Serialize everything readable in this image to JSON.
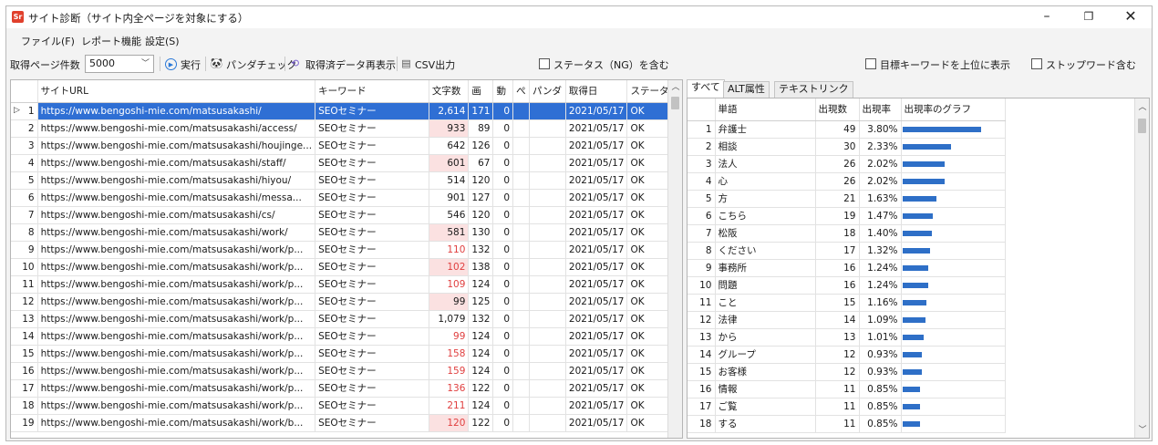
{
  "window": {
    "title": "サイト診断（サイト内全ページを対象にする）",
    "app_icon_text": "Sr",
    "minimize": "–",
    "maximize": "❐",
    "close": "✕"
  },
  "menu": [
    {
      "label": "ファイル(F)"
    },
    {
      "label": "レポート機能"
    },
    {
      "label": "設定(S)"
    }
  ],
  "toolbar": {
    "page_count_label": "取得ページ件数",
    "page_count_value": "5000",
    "run_label": "実行",
    "panda_label": "パンダチェック",
    "redisplay_label": "取得済データ再表示",
    "csv_label": "CSV出力",
    "status_ng_label": "ステータス（NG）を含む",
    "target_kw_label": "目標キーワードを上位に表示",
    "stopword_label": "ストップワード含む"
  },
  "left_grid": {
    "columns": [
      "サイトURL",
      "キーワード",
      "文字数",
      "画",
      "動",
      "ぺ",
      "パンダ",
      "取得日",
      "ステータス"
    ],
    "rows": [
      {
        "n": "1",
        "url": "https://www.bengoshi-mie.com/matsusakashi/",
        "kw": "SEOセミナー",
        "chars": "2,614",
        "img": "171",
        "mov": "0",
        "pe": "",
        "panda": "",
        "date": "2021/05/17",
        "status": "OK",
        "warn": false,
        "selected": true
      },
      {
        "n": "2",
        "url": "https://www.bengoshi-mie.com/matsusakashi/access/",
        "kw": "SEOセミナー",
        "chars": "933",
        "img": "89",
        "mov": "0",
        "pe": "",
        "panda": "",
        "date": "2021/05/17",
        "status": "OK",
        "warn": "cell"
      },
      {
        "n": "3",
        "url": "https://www.bengoshi-mie.com/matsusakashi/houjinge...",
        "kw": "SEOセミナー",
        "chars": "642",
        "img": "126",
        "mov": "0",
        "pe": "",
        "panda": "",
        "date": "2021/05/17",
        "status": "OK",
        "warn": false
      },
      {
        "n": "4",
        "url": "https://www.bengoshi-mie.com/matsusakashi/staff/",
        "kw": "SEOセミナー",
        "chars": "601",
        "img": "67",
        "mov": "0",
        "pe": "",
        "panda": "",
        "date": "2021/05/17",
        "status": "OK",
        "warn": "cell"
      },
      {
        "n": "5",
        "url": "https://www.bengoshi-mie.com/matsusakashi/hiyou/",
        "kw": "SEOセミナー",
        "chars": "514",
        "img": "120",
        "mov": "0",
        "pe": "",
        "panda": "",
        "date": "2021/05/17",
        "status": "OK",
        "warn": false
      },
      {
        "n": "6",
        "url": "https://www.bengoshi-mie.com/matsusakashi/messa...",
        "kw": "SEOセミナー",
        "chars": "901",
        "img": "127",
        "mov": "0",
        "pe": "",
        "panda": "",
        "date": "2021/05/17",
        "status": "OK",
        "warn": false
      },
      {
        "n": "7",
        "url": "https://www.bengoshi-mie.com/matsusakashi/cs/",
        "kw": "SEOセミナー",
        "chars": "546",
        "img": "120",
        "mov": "0",
        "pe": "",
        "panda": "",
        "date": "2021/05/17",
        "status": "OK",
        "warn": false
      },
      {
        "n": "8",
        "url": "https://www.bengoshi-mie.com/matsusakashi/work/",
        "kw": "SEOセミナー",
        "chars": "581",
        "img": "130",
        "mov": "0",
        "pe": "",
        "panda": "",
        "date": "2021/05/17",
        "status": "OK",
        "warn": "cell"
      },
      {
        "n": "9",
        "url": "https://www.bengoshi-mie.com/matsusakashi/work/p...",
        "kw": "SEOセミナー",
        "chars": "110",
        "img": "132",
        "mov": "0",
        "pe": "",
        "panda": "",
        "date": "2021/05/17",
        "status": "OK",
        "warn": "text"
      },
      {
        "n": "10",
        "url": "https://www.bengoshi-mie.com/matsusakashi/work/p...",
        "kw": "SEOセミナー",
        "chars": "102",
        "img": "138",
        "mov": "0",
        "pe": "",
        "panda": "",
        "date": "2021/05/17",
        "status": "OK",
        "warn": "both"
      },
      {
        "n": "11",
        "url": "https://www.bengoshi-mie.com/matsusakashi/work/p...",
        "kw": "SEOセミナー",
        "chars": "109",
        "img": "124",
        "mov": "0",
        "pe": "",
        "panda": "",
        "date": "2021/05/17",
        "status": "OK",
        "warn": "text"
      },
      {
        "n": "12",
        "url": "https://www.bengoshi-mie.com/matsusakashi/work/p...",
        "kw": "SEOセミナー",
        "chars": "99",
        "img": "125",
        "mov": "0",
        "pe": "",
        "panda": "",
        "date": "2021/05/17",
        "status": "OK",
        "warn": "cell"
      },
      {
        "n": "13",
        "url": "https://www.bengoshi-mie.com/matsusakashi/work/p...",
        "kw": "SEOセミナー",
        "chars": "1,079",
        "img": "132",
        "mov": "0",
        "pe": "",
        "panda": "",
        "date": "2021/05/17",
        "status": "OK",
        "warn": false
      },
      {
        "n": "14",
        "url": "https://www.bengoshi-mie.com/matsusakashi/work/p...",
        "kw": "SEOセミナー",
        "chars": "99",
        "img": "124",
        "mov": "0",
        "pe": "",
        "panda": "",
        "date": "2021/05/17",
        "status": "OK",
        "warn": "text"
      },
      {
        "n": "15",
        "url": "https://www.bengoshi-mie.com/matsusakashi/work/p...",
        "kw": "SEOセミナー",
        "chars": "158",
        "img": "124",
        "mov": "0",
        "pe": "",
        "panda": "",
        "date": "2021/05/17",
        "status": "OK",
        "warn": "text"
      },
      {
        "n": "16",
        "url": "https://www.bengoshi-mie.com/matsusakashi/work/p...",
        "kw": "SEOセミナー",
        "chars": "159",
        "img": "124",
        "mov": "0",
        "pe": "",
        "panda": "",
        "date": "2021/05/17",
        "status": "OK",
        "warn": "text"
      },
      {
        "n": "17",
        "url": "https://www.bengoshi-mie.com/matsusakashi/work/p...",
        "kw": "SEOセミナー",
        "chars": "136",
        "img": "122",
        "mov": "0",
        "pe": "",
        "panda": "",
        "date": "2021/05/17",
        "status": "OK",
        "warn": "text"
      },
      {
        "n": "18",
        "url": "https://www.bengoshi-mie.com/matsusakashi/work/p...",
        "kw": "SEOセミナー",
        "chars": "211",
        "img": "124",
        "mov": "0",
        "pe": "",
        "panda": "",
        "date": "2021/05/17",
        "status": "OK",
        "warn": "text"
      },
      {
        "n": "19",
        "url": "https://www.bengoshi-mie.com/matsusakashi/work/b...",
        "kw": "SEOセミナー",
        "chars": "120",
        "img": "122",
        "mov": "0",
        "pe": "",
        "panda": "",
        "date": "2021/05/17",
        "status": "OK",
        "warn": "both"
      }
    ]
  },
  "right_tabs": [
    {
      "label": "すべて",
      "active": true
    },
    {
      "label": "ALT属性",
      "active": false
    },
    {
      "label": "テキストリンク",
      "active": false
    }
  ],
  "right_grid": {
    "columns": [
      "単語",
      "出現数",
      "出現率",
      "出現率のグラフ"
    ],
    "rows": [
      {
        "n": "1",
        "word": "弁護士",
        "count": "49",
        "rate": "3.80%",
        "frac": 1.0
      },
      {
        "n": "2",
        "word": "相談",
        "count": "30",
        "rate": "2.33%",
        "frac": 0.613
      },
      {
        "n": "3",
        "word": "法人",
        "count": "26",
        "rate": "2.02%",
        "frac": 0.532
      },
      {
        "n": "4",
        "word": "心",
        "count": "26",
        "rate": "2.02%",
        "frac": 0.532
      },
      {
        "n": "5",
        "word": "方",
        "count": "21",
        "rate": "1.63%",
        "frac": 0.429
      },
      {
        "n": "6",
        "word": "こちら",
        "count": "19",
        "rate": "1.47%",
        "frac": 0.387
      },
      {
        "n": "7",
        "word": "松阪",
        "count": "18",
        "rate": "1.40%",
        "frac": 0.368
      },
      {
        "n": "8",
        "word": "ください",
        "count": "17",
        "rate": "1.32%",
        "frac": 0.347
      },
      {
        "n": "9",
        "word": "事務所",
        "count": "16",
        "rate": "1.24%",
        "frac": 0.326
      },
      {
        "n": "10",
        "word": "問題",
        "count": "16",
        "rate": "1.24%",
        "frac": 0.326
      },
      {
        "n": "11",
        "word": "こと",
        "count": "15",
        "rate": "1.16%",
        "frac": 0.305
      },
      {
        "n": "12",
        "word": "法律",
        "count": "14",
        "rate": "1.09%",
        "frac": 0.287
      },
      {
        "n": "13",
        "word": "から",
        "count": "13",
        "rate": "1.01%",
        "frac": 0.266
      },
      {
        "n": "14",
        "word": "グループ",
        "count": "12",
        "rate": "0.93%",
        "frac": 0.245
      },
      {
        "n": "15",
        "word": "お客様",
        "count": "12",
        "rate": "0.93%",
        "frac": 0.245
      },
      {
        "n": "16",
        "word": "情報",
        "count": "11",
        "rate": "0.85%",
        "frac": 0.224
      },
      {
        "n": "17",
        "word": "ご覧",
        "count": "11",
        "rate": "0.85%",
        "frac": 0.224
      },
      {
        "n": "18",
        "word": "する",
        "count": "11",
        "rate": "0.85%",
        "frac": 0.224
      }
    ]
  },
  "colors": {
    "selection": "#2f6fd4",
    "warn_bg": "#fbe1e1",
    "warn_text": "#e04040",
    "bar": "#2e6fc7"
  }
}
